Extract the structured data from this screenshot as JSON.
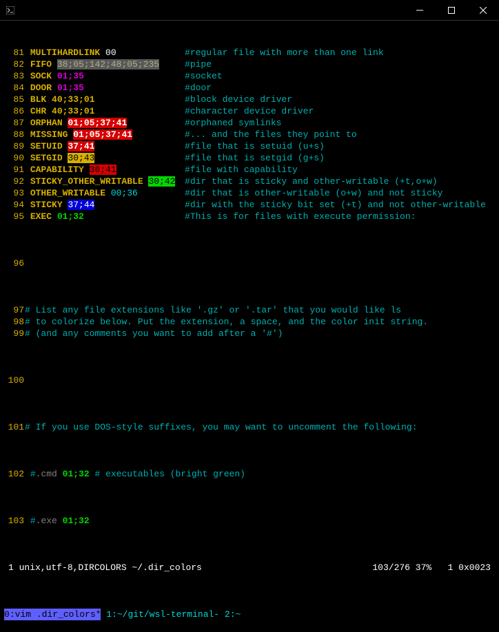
{
  "lines": [
    {
      "n": "81",
      "key": "MULTIHARDLINK",
      "kcls": "yellowbold",
      "val": "00",
      "vcls": "white",
      "comment": "regular file with more than one link"
    },
    {
      "n": "82",
      "key": "FIFO",
      "kcls": "yellowbold",
      "val": "38;05;142;48;05;235",
      "vcls": "fifo-val",
      "comment": "pipe"
    },
    {
      "n": "83",
      "key": "SOCK",
      "kcls": "yellowbold",
      "val": "01;35",
      "vcls": "magenta",
      "comment": "socket"
    },
    {
      "n": "84",
      "key": "DOOR",
      "kcls": "yellowbold",
      "val": "01;35",
      "vcls": "magenta",
      "comment": "door"
    },
    {
      "n": "85",
      "key": "BLK",
      "kcls": "yellowbold",
      "val": "40;33;01",
      "vcls": "yellowbold",
      "comment": "block device driver"
    },
    {
      "n": "86",
      "key": "CHR",
      "kcls": "yellowbold",
      "val": "40;33;01",
      "vcls": "yellowbold",
      "comment": "character device driver"
    },
    {
      "n": "87",
      "key": "ORPHAN",
      "kcls": "yellowbold",
      "val": "01;05;37;41",
      "vcls": "bg-red-white",
      "comment": "orphaned symlinks"
    },
    {
      "n": "88",
      "key": "MISSING",
      "kcls": "yellowbold",
      "val": "01;05;37;41",
      "vcls": "bg-red-white",
      "comment": "... and the files they point to"
    },
    {
      "n": "89",
      "key": "SETUID",
      "kcls": "yellowbold",
      "val": "37;41",
      "vcls": "bg-red-white",
      "comment": "file that is setuid (u+s)"
    },
    {
      "n": "90",
      "key": "SETGID",
      "kcls": "yellowbold",
      "val": "30;43",
      "vcls": "bg-yellow-black",
      "comment": "file that is setgid (g+s)"
    },
    {
      "n": "91",
      "key": "CAPABILITY",
      "kcls": "yellowbold",
      "val": "30;41",
      "vcls": "bg-red-black",
      "comment": "file with capability"
    },
    {
      "n": "92",
      "key": "STICKY_OTHER_WRITABLE",
      "kcls": "yellowbold",
      "val": "30;42",
      "vcls": "bg-green-black",
      "comment": "dir that is sticky and other-writable (+t,o+w)"
    },
    {
      "n": "93",
      "key": "OTHER_WRITABLE",
      "kcls": "yellowbold",
      "val": "00;36",
      "vcls": "cyan",
      "comment": "dir that is other-writable (o+w) and not sticky"
    },
    {
      "n": "94",
      "key": "STICKY",
      "kcls": "yellowbold",
      "val": "37;44",
      "vcls": "bg-blue-white",
      "comment": "dir with the sticky bit set (+t) and not other-writable"
    },
    {
      "n": "95",
      "key": "EXEC",
      "kcls": "yellowbold",
      "val": "01;32",
      "vcls": "greenbold",
      "comment": "This is for files with execute permission:"
    }
  ],
  "blank96": "96",
  "comments": [
    {
      "n": "97",
      "text": "# List any file extensions like '.gz' or '.tar' that you would like ls"
    },
    {
      "n": "98",
      "text": "# to colorize below. Put the extension, a space, and the color init string."
    },
    {
      "n": "99",
      "text": "# (and any comments you want to add after a '#')"
    }
  ],
  "blank100": "100",
  "comments2": [
    {
      "n": "101",
      "text": "# If you use DOS-style suffixes, you may want to uncomment the following:"
    }
  ],
  "cmd102": {
    "n": "102",
    "hash": "#",
    "key": ".cmd",
    "val": "01;32",
    "comment": "# executables (bright green)"
  },
  "cmd103": {
    "n": "103",
    "hash": "#",
    "key": ".exe",
    "val": "01;32"
  },
  "status": {
    "left": "1 unix,utf-8,DIRCOLORS ~/.dir_colors",
    "right": "103/276 37%   1 0x0023"
  },
  "tabs": {
    "t0_idx": "0:",
    "t0_name": "vim .dir_colors",
    "t0_star": "*",
    "t1": "1:~/git/wsl-terminal-",
    "t2": "2:~"
  }
}
